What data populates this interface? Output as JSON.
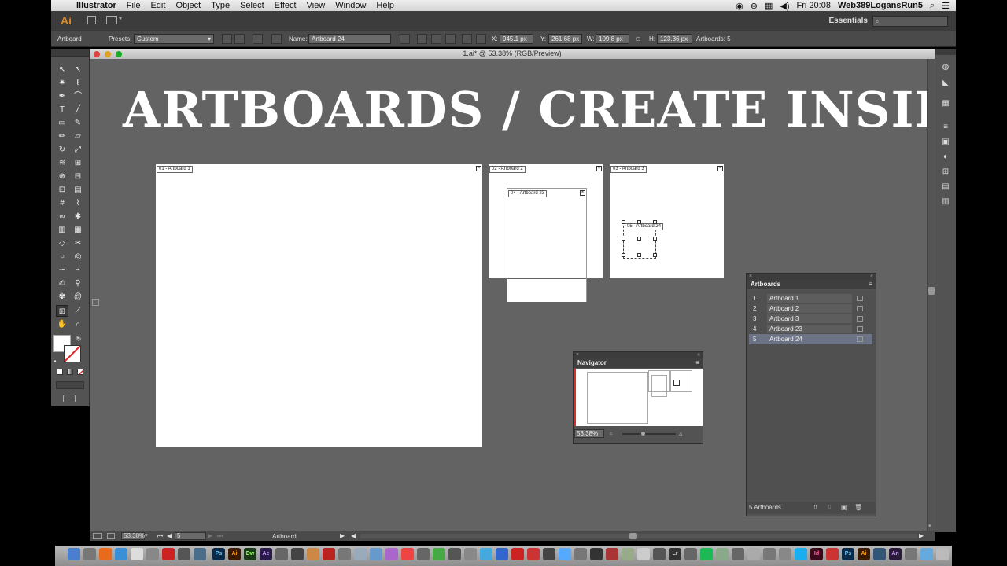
{
  "menubar": {
    "app": "Illustrator",
    "items": [
      "File",
      "Edit",
      "Object",
      "Type",
      "Select",
      "Effect",
      "View",
      "Window",
      "Help"
    ],
    "clock": "Fri 20:08",
    "user": "Web389LogansRun5"
  },
  "appbar": {
    "logo": "Ai",
    "workspace": "Essentials"
  },
  "controlbar": {
    "mode": "Artboard",
    "presets_label": "Presets:",
    "presets_value": "Custom",
    "name_label": "Name:",
    "name_value": "Artboard 24",
    "x_label": "X:",
    "x_value": "945.1 px",
    "y_label": "Y:",
    "y_value": "261.68 px",
    "w_label": "W:",
    "w_value": "109.8 px",
    "h_label": "H:",
    "h_value": "123.36 px",
    "artboards_label": "Artboards: 5"
  },
  "document": {
    "title": "1.ai* @ 53.38% (RGB/Preview)"
  },
  "canvas": {
    "heading": "ARTBOARDS / CREATE INSIDE",
    "artboards": [
      {
        "label": "01 - Artboard 1"
      },
      {
        "label": "02 - Artboard 2"
      },
      {
        "label": "03 - Artboard 3"
      },
      {
        "label": "04 - Artboard 23"
      },
      {
        "label": "05 - Artboard 24"
      }
    ]
  },
  "artboards_panel": {
    "title": "Artboards",
    "rows": [
      {
        "num": "1",
        "name": "Artboard 1"
      },
      {
        "num": "2",
        "name": "Artboard 2"
      },
      {
        "num": "3",
        "name": "Artboard 3"
      },
      {
        "num": "4",
        "name": "Artboard 23"
      },
      {
        "num": "5",
        "name": "Artboard 24"
      }
    ],
    "selected_row": 5,
    "footer": "5 Artboards"
  },
  "navigator_panel": {
    "title": "Navigator",
    "zoom": "53.38%"
  },
  "statusbar": {
    "zoom": "53.38%",
    "artboard_num": "5",
    "tool": "Artboard"
  },
  "colors": {
    "canvas": "#636363",
    "panel": "#535353",
    "selection": "#6b7385",
    "ai_orange": "#d68b2c"
  }
}
